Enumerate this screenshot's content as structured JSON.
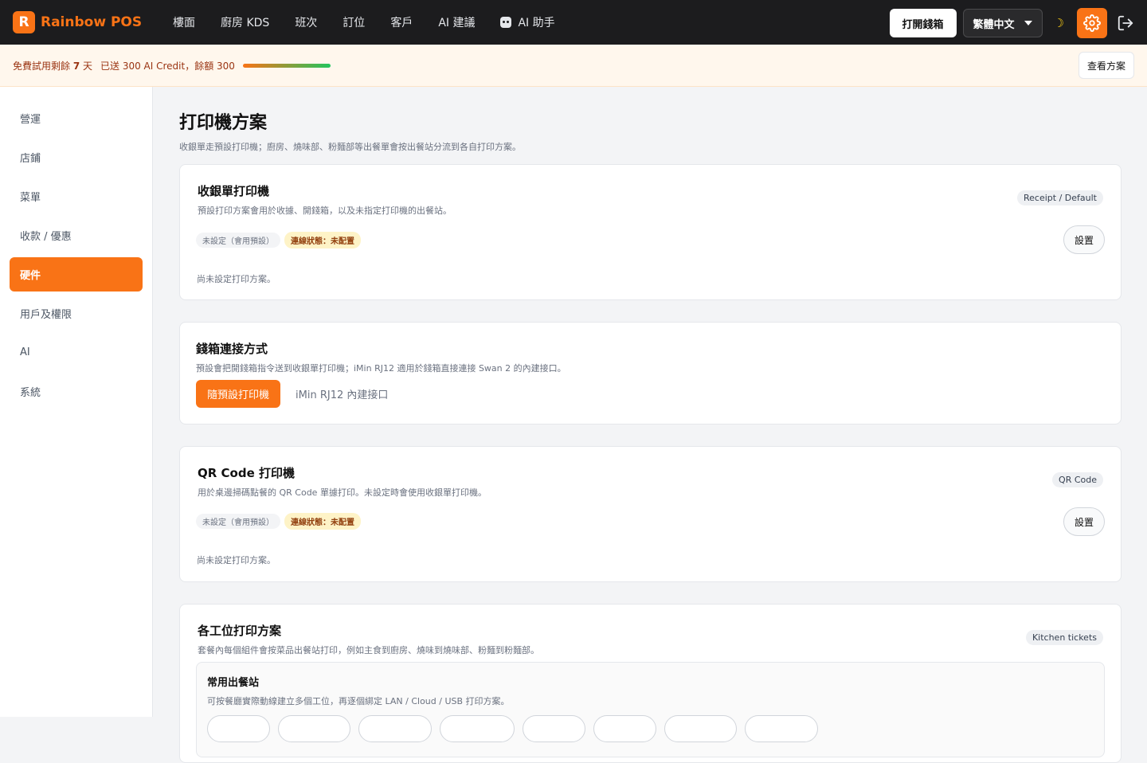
{
  "brand": {
    "logo_letter": "R",
    "name": "Rainbow POS",
    "accent": "#f97316"
  },
  "nav": [
    {
      "label": "樓面"
    },
    {
      "label": "廚房 KDS"
    },
    {
      "label": "班次"
    },
    {
      "label": "訂位"
    },
    {
      "label": "客戶"
    },
    {
      "label": "AI 建議"
    },
    {
      "label": "AI 助手",
      "icon": "robot-icon"
    }
  ],
  "topbar": {
    "open_drawer": "打開錢箱",
    "language": "繁體中文",
    "theme_icon": "moon-icon",
    "settings_icon": "gear-icon",
    "logout_icon": "logout-icon"
  },
  "trial": {
    "prefix": "免費試用剩餘 ",
    "days": "7",
    "suffix": " 天",
    "credit_text": "已送 300 AI Credit，餘額 300",
    "credit_fraction": 1.0,
    "view_plan": "查看方案"
  },
  "sidebar": [
    {
      "label": "營運",
      "active": false
    },
    {
      "label": "店鋪",
      "active": false
    },
    {
      "label": "菜單",
      "active": false
    },
    {
      "label": "收款 / 優惠",
      "active": false
    },
    {
      "label": "硬件",
      "active": true
    },
    {
      "label": "用戶及權限",
      "active": false
    },
    {
      "label": "AI",
      "active": false
    },
    {
      "label": "系統",
      "active": false
    }
  ],
  "page": {
    "title": "打印機方案",
    "subtitle": "收銀單走預設打印機；廚房、燒味部、粉麵部等出餐單會按出餐站分流到各自打印方案。"
  },
  "receipt_card": {
    "title": "收銀單打印機",
    "desc": "預設打印方案會用於收據、開錢箱，以及未指定打印機的出餐站。",
    "pill": "Receipt / Default",
    "tag_setting": "未設定（會用預設）",
    "tag_status": "連線狀態：未配置",
    "button": "設置",
    "note": "尚未設定打印方案。"
  },
  "drawer_card": {
    "title": "錢箱連接方式",
    "desc": "預設會把開錢箱指令送到收銀單打印機；iMin RJ12 適用於錢箱直接連接 Swan 2 的內建接口。",
    "option_active": "隨預設打印機",
    "option_other": "iMin RJ12 內建接口"
  },
  "qr_card": {
    "title": "QR Code 打印機",
    "desc": "用於桌邊掃碼點餐的 QR Code 單據打印。未設定時會使用收銀單打印機。",
    "pill": "QR Code",
    "tag_setting": "未設定（會用預設）",
    "tag_status": "連線狀態：未配置",
    "button": "設置",
    "note": "尚未設定打印方案。"
  },
  "station_card": {
    "title": "各工位打印方案",
    "desc": "套餐內每個組件會按菜品出餐站打印，例如主食到廚房、燒味到燒味部、粉麵到粉麵部。",
    "pill": "Kitchen tickets",
    "box_title": "常用出餐站",
    "box_desc": "可按餐廳實際動線建立多個工位，再逐個綁定 LAN / Cloud / USB 打印方案。"
  }
}
